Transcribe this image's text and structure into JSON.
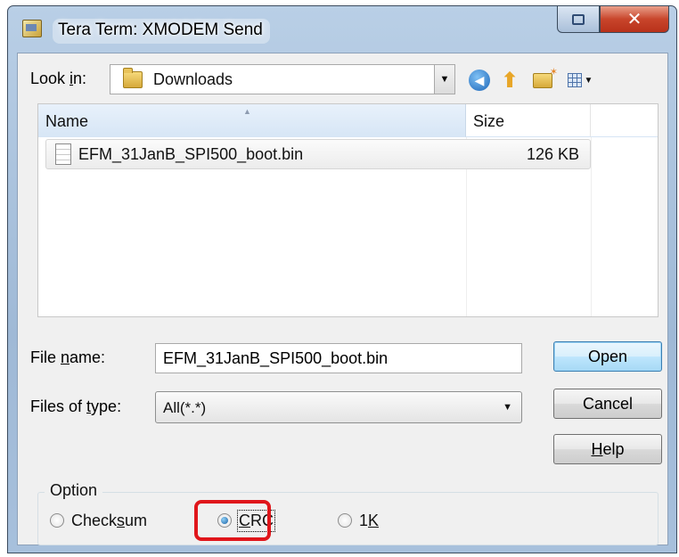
{
  "window": {
    "title": "Tera Term: XMODEM Send"
  },
  "toolbar": {
    "look_in_label_pre": "Look ",
    "look_in_label_ul": "i",
    "look_in_label_post": "n:",
    "look_in_value": "Downloads",
    "icons": [
      "back-icon",
      "up-folder-icon",
      "new-folder-icon",
      "views-menu-icon"
    ]
  },
  "file_list": {
    "columns": [
      "Name",
      "Size"
    ],
    "rows": [
      {
        "name": "EFM_31JanB_SPI500_boot.bin",
        "size": "126 KB"
      }
    ]
  },
  "form": {
    "file_name_label_pre": "File ",
    "file_name_label_ul": "n",
    "file_name_label_post": "ame:",
    "file_name_value": "EFM_31JanB_SPI500_boot.bin",
    "files_of_type_label_pre": "Files of ",
    "files_of_type_label_ul": "t",
    "files_of_type_label_post": "ype:",
    "files_of_type_value": "All(*.*)"
  },
  "buttons": {
    "open": "Open",
    "cancel": "Cancel",
    "help_ul": "H",
    "help_rest": "elp"
  },
  "option_group": {
    "title": "Option",
    "options": [
      {
        "label_pre": "Check",
        "label_ul": "s",
        "label_post": "um",
        "selected": false
      },
      {
        "label_pre": "",
        "label_ul": "C",
        "label_post": "RC",
        "selected": true
      },
      {
        "label_pre": "1",
        "label_ul": "K",
        "label_post": "",
        "selected": false
      }
    ]
  },
  "colors": {
    "highlight": "#e0161b",
    "close_button": "#c8452b",
    "selected_header": "#d7e6f6"
  }
}
